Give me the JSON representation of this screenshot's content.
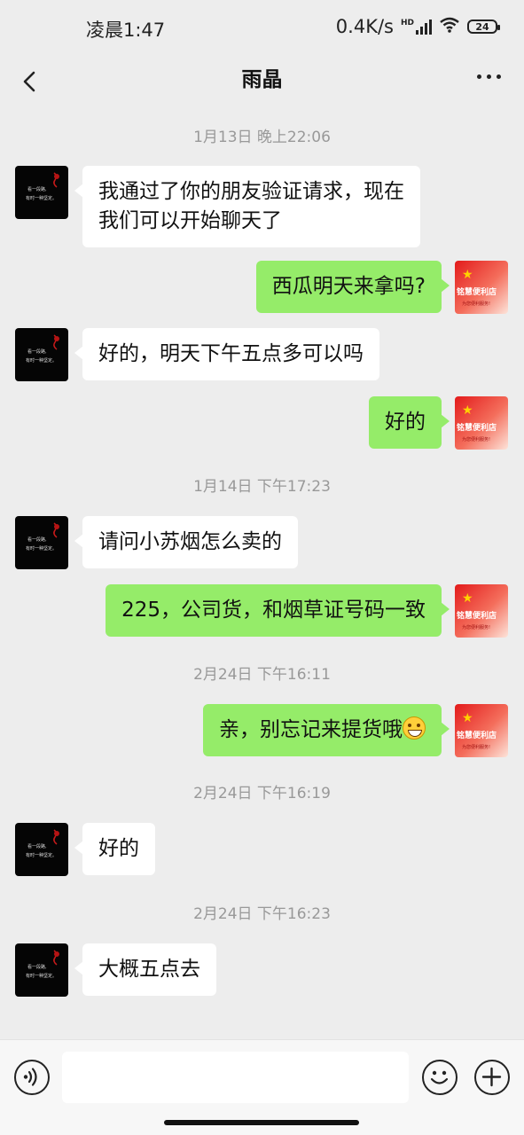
{
  "status_bar": {
    "time": "凌晨1:47",
    "network_speed": "0.4K/s",
    "hd_label": "HD",
    "battery": "24"
  },
  "header": {
    "title": "雨晶",
    "back_icon": "chevron-left-icon",
    "more_icon": "more-horizontal-icon"
  },
  "chat": {
    "timestamps": [
      "1月13日 晚上22:06",
      "1月14日 下午17:23",
      "2月24日 下午16:11",
      "2月24日 下午16:19",
      "2月24日 下午16:23"
    ],
    "messages": [
      {
        "side": "left",
        "line1": "我通过了你的朋友验证请求，现在",
        "line2": "我们可以开始聊天了"
      },
      {
        "side": "right",
        "text": "西瓜明天来拿吗?"
      },
      {
        "side": "left",
        "text": "好的，明天下午五点多可以吗"
      },
      {
        "side": "right",
        "text": "好的"
      },
      {
        "side": "left",
        "text": "请问小苏烟怎么卖的"
      },
      {
        "side": "right",
        "text": "225，公司货，和烟草证号码一致"
      },
      {
        "side": "right",
        "text": "亲，别忘记来提货哦"
      },
      {
        "side": "left",
        "text": "好的"
      },
      {
        "side": "left",
        "text": "大概五点去"
      }
    ],
    "contact_avatar": {
      "line1": "看一段路,",
      "line2": "有时一种坚定。"
    },
    "self_avatar": {
      "line1": "铭慧便利店",
      "line2": "为您便利服务!"
    }
  },
  "input_bar": {
    "voice_icon": "voice-icon",
    "emoji_icon": "emoji-icon",
    "plus_icon": "plus-icon",
    "placeholder": ""
  },
  "colors": {
    "background": "#ededed",
    "bubble_self": "#95ec69",
    "bubble_other": "#ffffff",
    "timestamp": "#999999"
  }
}
